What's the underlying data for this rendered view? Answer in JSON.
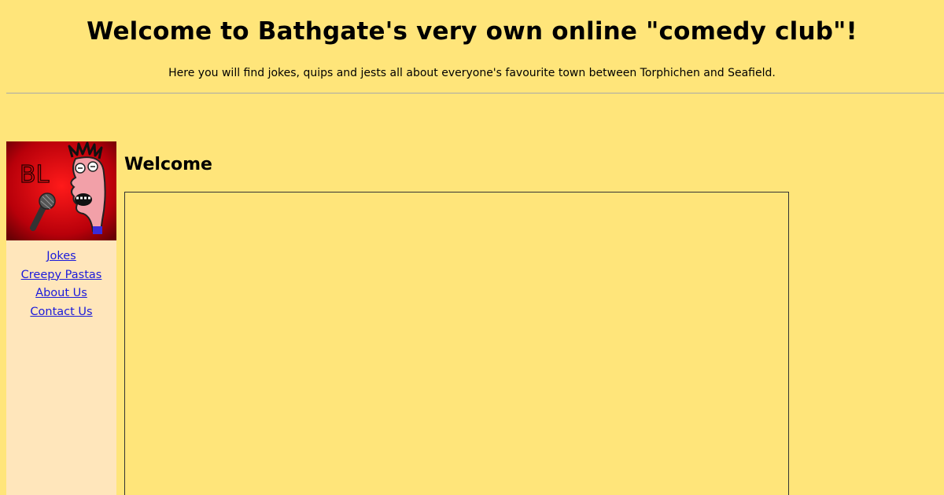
{
  "header": {
    "title": "Welcome to Bathgate's very own online \"comedy club\"!",
    "subtitle": "Here you will find jokes, quips and jests all about everyone's favourite town between Torphichen and Seafield."
  },
  "sidebar": {
    "logo_letters": "BL",
    "nav": [
      {
        "label": "Jokes"
      },
      {
        "label": "Creepy Pastas"
      },
      {
        "label": "About Us"
      },
      {
        "label": "Contact Us"
      }
    ]
  },
  "main": {
    "heading": "Welcome"
  },
  "colors": {
    "page_background": "#ffe57a",
    "sidebar_background": "#ffe6bb",
    "link": "#1a1adb",
    "logo_red": "#c8000c"
  }
}
